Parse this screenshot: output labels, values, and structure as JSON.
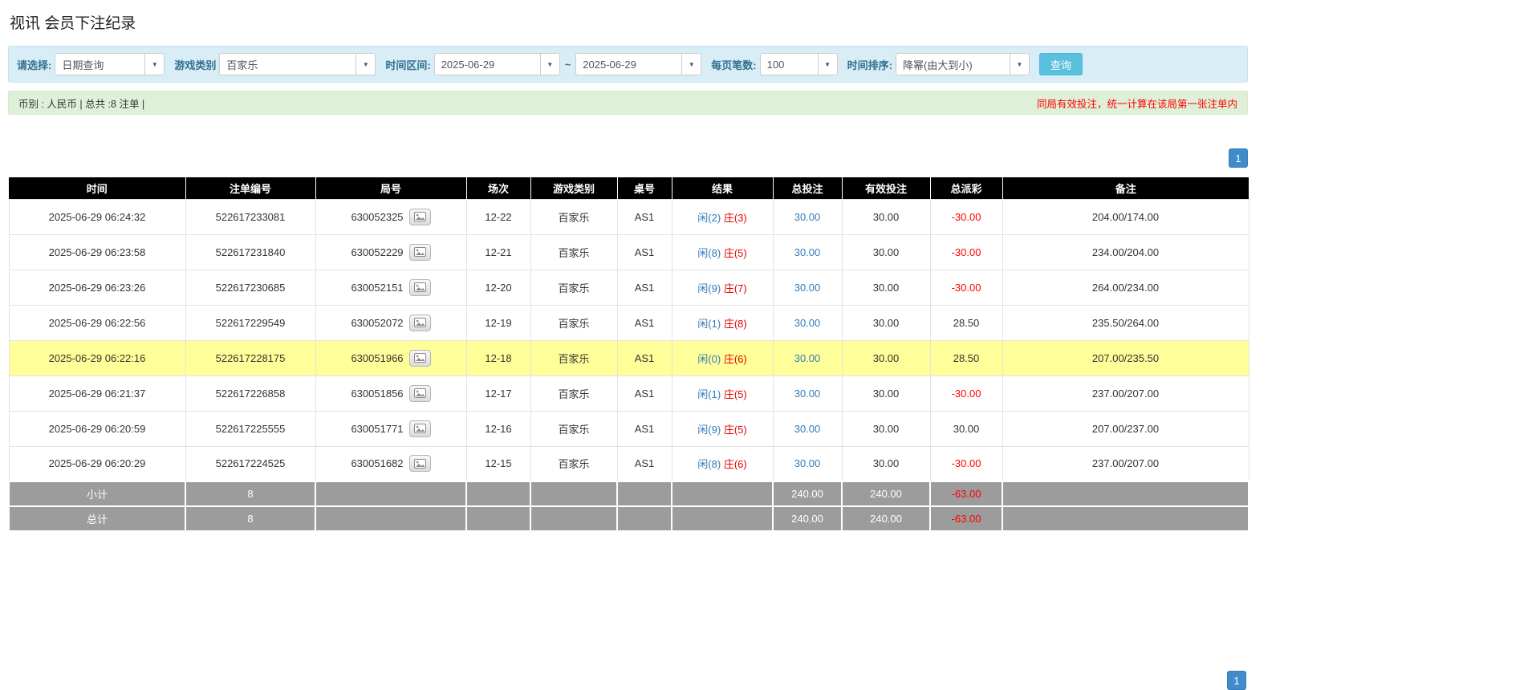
{
  "page": {
    "title": "视讯 会员下注纪录"
  },
  "icons": {
    "caret": "▼"
  },
  "filters": {
    "select_label": "请选择:",
    "select_value": "日期查询",
    "game_type_label": "游戏类别",
    "game_type_value": "百家乐",
    "date_range_label": "时间区间:",
    "date_from": "2025-06-29",
    "date_separator": "~",
    "date_to": "2025-06-29",
    "page_size_label": "每页笔数:",
    "page_size_value": "100",
    "sort_label": "时间排序:",
    "sort_value": "降幂(由大到小)",
    "search_button_label": "查询"
  },
  "summary": {
    "currency_info": "币别 : 人民币 | 总共 :8 注单 |",
    "notice": "同局有效投注，统一计算在该局第一张注单内"
  },
  "pagination": {
    "page": "1"
  },
  "table": {
    "headers": [
      "时间",
      "注单编号",
      "局号",
      "场次",
      "游戏类别",
      "桌号",
      "结果",
      "总投注",
      "有效投注",
      "总派彩",
      "备注"
    ],
    "rows": [
      {
        "time": "2025-06-29 06:24:32",
        "order_no": "522617233081",
        "round_no": "630052325",
        "session": "12-22",
        "game": "百家乐",
        "table_no": "AS1",
        "player": "闲(2)",
        "banker": "庄(3)",
        "total_bet": "30.00",
        "valid_bet": "30.00",
        "payout": "-30.00",
        "note": "204.00/174.00",
        "highlight": false
      },
      {
        "time": "2025-06-29 06:23:58",
        "order_no": "522617231840",
        "round_no": "630052229",
        "session": "12-21",
        "game": "百家乐",
        "table_no": "AS1",
        "player": "闲(8)",
        "banker": "庄(5)",
        "total_bet": "30.00",
        "valid_bet": "30.00",
        "payout": "-30.00",
        "note": "234.00/204.00",
        "highlight": false
      },
      {
        "time": "2025-06-29 06:23:26",
        "order_no": "522617230685",
        "round_no": "630052151",
        "session": "12-20",
        "game": "百家乐",
        "table_no": "AS1",
        "player": "闲(9)",
        "banker": "庄(7)",
        "total_bet": "30.00",
        "valid_bet": "30.00",
        "payout": "-30.00",
        "note": "264.00/234.00",
        "highlight": false
      },
      {
        "time": "2025-06-29 06:22:56",
        "order_no": "522617229549",
        "round_no": "630052072",
        "session": "12-19",
        "game": "百家乐",
        "table_no": "AS1",
        "player": "闲(1)",
        "banker": "庄(8)",
        "total_bet": "30.00",
        "valid_bet": "30.00",
        "payout": "28.50",
        "note": "235.50/264.00",
        "highlight": false
      },
      {
        "time": "2025-06-29 06:22:16",
        "order_no": "522617228175",
        "round_no": "630051966",
        "session": "12-18",
        "game": "百家乐",
        "table_no": "AS1",
        "player": "闲(0)",
        "banker": "庄(6)",
        "total_bet": "30.00",
        "valid_bet": "30.00",
        "payout": "28.50",
        "note": "207.00/235.50",
        "highlight": true
      },
      {
        "time": "2025-06-29 06:21:37",
        "order_no": "522617226858",
        "round_no": "630051856",
        "session": "12-17",
        "game": "百家乐",
        "table_no": "AS1",
        "player": "闲(1)",
        "banker": "庄(5)",
        "total_bet": "30.00",
        "valid_bet": "30.00",
        "payout": "-30.00",
        "note": "237.00/207.00",
        "highlight": false
      },
      {
        "time": "2025-06-29 06:20:59",
        "order_no": "522617225555",
        "round_no": "630051771",
        "session": "12-16",
        "game": "百家乐",
        "table_no": "AS1",
        "player": "闲(9)",
        "banker": "庄(5)",
        "total_bet": "30.00",
        "valid_bet": "30.00",
        "payout": "30.00",
        "note": "207.00/237.00",
        "highlight": false
      },
      {
        "time": "2025-06-29 06:20:29",
        "order_no": "522617224525",
        "round_no": "630051682",
        "session": "12-15",
        "game": "百家乐",
        "table_no": "AS1",
        "player": "闲(8)",
        "banker": "庄(6)",
        "total_bet": "30.00",
        "valid_bet": "30.00",
        "payout": "-30.00",
        "note": "237.00/207.00",
        "highlight": false
      }
    ],
    "footer_rows": [
      {
        "label": "小计",
        "count": "8",
        "total_bet": "240.00",
        "valid_bet": "240.00",
        "payout": "-63.00"
      },
      {
        "label": "总计",
        "count": "8",
        "total_bet": "240.00",
        "valid_bet": "240.00",
        "payout": "-63.00"
      }
    ]
  }
}
